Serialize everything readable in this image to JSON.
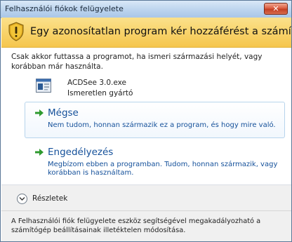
{
  "window": {
    "title": "Felhasználói fiókok felügyelete",
    "close_label": "✕"
  },
  "banner": {
    "text": "Egy azonosítatlan program kér hozzáférést a számítógéphez",
    "icon": "uac-shield-icon"
  },
  "intro": {
    "text": "Csak akkor futtassa a programot, ha ismeri származási helyét, vagy korábban már használta."
  },
  "program": {
    "name": "ACDSee 3.0.exe",
    "publisher": "Ismeretlen gyártó",
    "icon": "application-icon"
  },
  "options": {
    "cancel": {
      "title": "Mégse",
      "description": "Nem tudom, honnan származik ez a program, és hogy mire való."
    },
    "allow": {
      "title": "Engedélyezés",
      "description": "Megbízom ebben a programban. Tudom, honnan származik, vagy korábban is használtam."
    }
  },
  "details": {
    "label": "Részletek"
  },
  "footer": {
    "text": "A Felhasználói fiók felügyelete eszköz segítségével megakadályozható a számítógép beállításainak illetéktelen módosítása."
  },
  "colors": {
    "banner": "#f5c64d",
    "link": "#14509a",
    "arrow": "#2e9a2e"
  }
}
